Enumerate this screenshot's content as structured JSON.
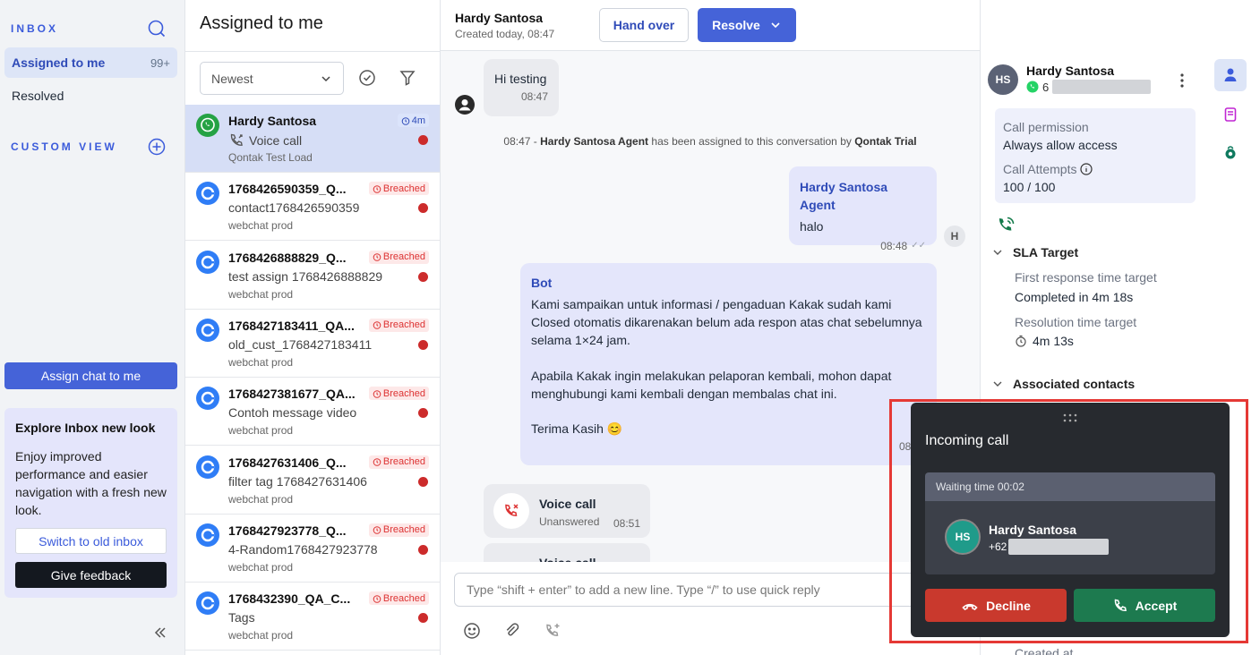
{
  "sidebar": {
    "inbox_heading": "INBOX",
    "nav": [
      {
        "label": "Assigned to me",
        "count": "99+"
      },
      {
        "label": "Resolved",
        "count": ""
      }
    ],
    "custom_view_heading": "CUSTOM VIEW",
    "assign_button": "Assign chat to me",
    "explore": {
      "title": "Explore Inbox new look",
      "description": "Enjoy improved performance and easier navigation with a fresh new look.",
      "switch_button": "Switch to old inbox",
      "feedback_button": "Give feedback"
    }
  },
  "list": {
    "title": "Assigned to me",
    "sort_value": "Newest",
    "conversations": [
      {
        "name": "Hardy Santosa",
        "message": "Voice call",
        "source": "Qontak Test Load",
        "badge": "4m",
        "badge_type": "time",
        "channel": "whatsapp",
        "active": true
      },
      {
        "name": "1768426590359_Q...",
        "message": "contact1768426590359",
        "source": "webchat prod",
        "badge": "Breached",
        "badge_type": "breach",
        "channel": "webchat"
      },
      {
        "name": "1768426888829_Q...",
        "message": "test assign 1768426888829",
        "source": "webchat prod",
        "badge": "Breached",
        "badge_type": "breach",
        "channel": "webchat"
      },
      {
        "name": "1768427183411_QA...",
        "message": "old_cust_1768427183411",
        "source": "webchat prod",
        "badge": "Breached",
        "badge_type": "breach",
        "channel": "webchat"
      },
      {
        "name": "1768427381677_QA...",
        "message": "Contoh message video",
        "source": "webchat prod",
        "badge": "Breached",
        "badge_type": "breach",
        "channel": "webchat"
      },
      {
        "name": "1768427631406_Q...",
        "message": "filter tag 1768427631406",
        "source": "webchat prod",
        "badge": "Breached",
        "badge_type": "breach",
        "channel": "webchat"
      },
      {
        "name": "1768427923778_Q...",
        "message": "4-Random1768427923778",
        "source": "webchat prod",
        "badge": "Breached",
        "badge_type": "breach",
        "channel": "webchat"
      },
      {
        "name": "1768432390_QA_C...",
        "message": "Tags",
        "source": "webchat prod",
        "badge": "Breached",
        "badge_type": "breach",
        "channel": "webchat"
      }
    ]
  },
  "chat": {
    "contact_name": "Hardy Santosa",
    "created": "Created today, 08:47",
    "handover_button": "Hand over",
    "resolve_button": "Resolve",
    "messages": {
      "m1_text": "Hi testing",
      "m1_time": "08:47",
      "system_time": "08:47",
      "system_agent": "Hardy Santosa Agent",
      "system_mid": "has been assigned to this conversation by",
      "system_by": "Qontak Trial",
      "m2_sender": "Hardy Santosa Agent",
      "m2_text": "halo",
      "m2_time": "08:48",
      "m2_avatar": "H",
      "m3_sender": "Bot",
      "m3_p1": "Kami sampaikan untuk informasi / pengaduan Kakak sudah kami Closed otomatis dikarenakan belum ada respon atas chat sebelumnya selama 1×24 jam.",
      "m3_p2": "Apabila Kakak ingin melakukan pelaporan kembali, mohon dapat menghubungi kami kembali dengan membalas chat ini.",
      "m3_p3": "Terima Kasih 😊",
      "m3_time": "08:51",
      "call_title": "Voice call",
      "call_status": "Unanswered",
      "call_time": "08:51",
      "call2_title": "Voice call"
    },
    "composer_placeholder": "Type “shift + enter” to add a new line. Type “/” to use quick reply"
  },
  "details": {
    "avatar": "HS",
    "name": "Hardy Santosa",
    "phone_prefix": "6",
    "call_permission_label": "Call permission",
    "call_permission_value": "Always allow access",
    "call_attempts_label": "Call Attempts",
    "call_attempts_value": "100 / 100",
    "sla_heading": "SLA Target",
    "first_response_label": "First response time target",
    "first_response_value": "Completed in 4m 18s",
    "resolution_label": "Resolution time target",
    "resolution_value": "4m 13s",
    "associated_heading": "Associated contacts",
    "created_at_label": "Created at"
  },
  "incoming_call": {
    "title": "Incoming call",
    "waiting": "Waiting time 00:02",
    "caller_avatar": "HS",
    "caller_name": "Hardy Santosa",
    "caller_phone_prefix": "+62",
    "decline_button": "Decline",
    "accept_button": "Accept"
  },
  "colors": {
    "accent": "#4563d8",
    "breach": "#d33333",
    "accept": "#1d7a4f",
    "decline": "#c9392d",
    "highlight_frame": "#e53935"
  }
}
